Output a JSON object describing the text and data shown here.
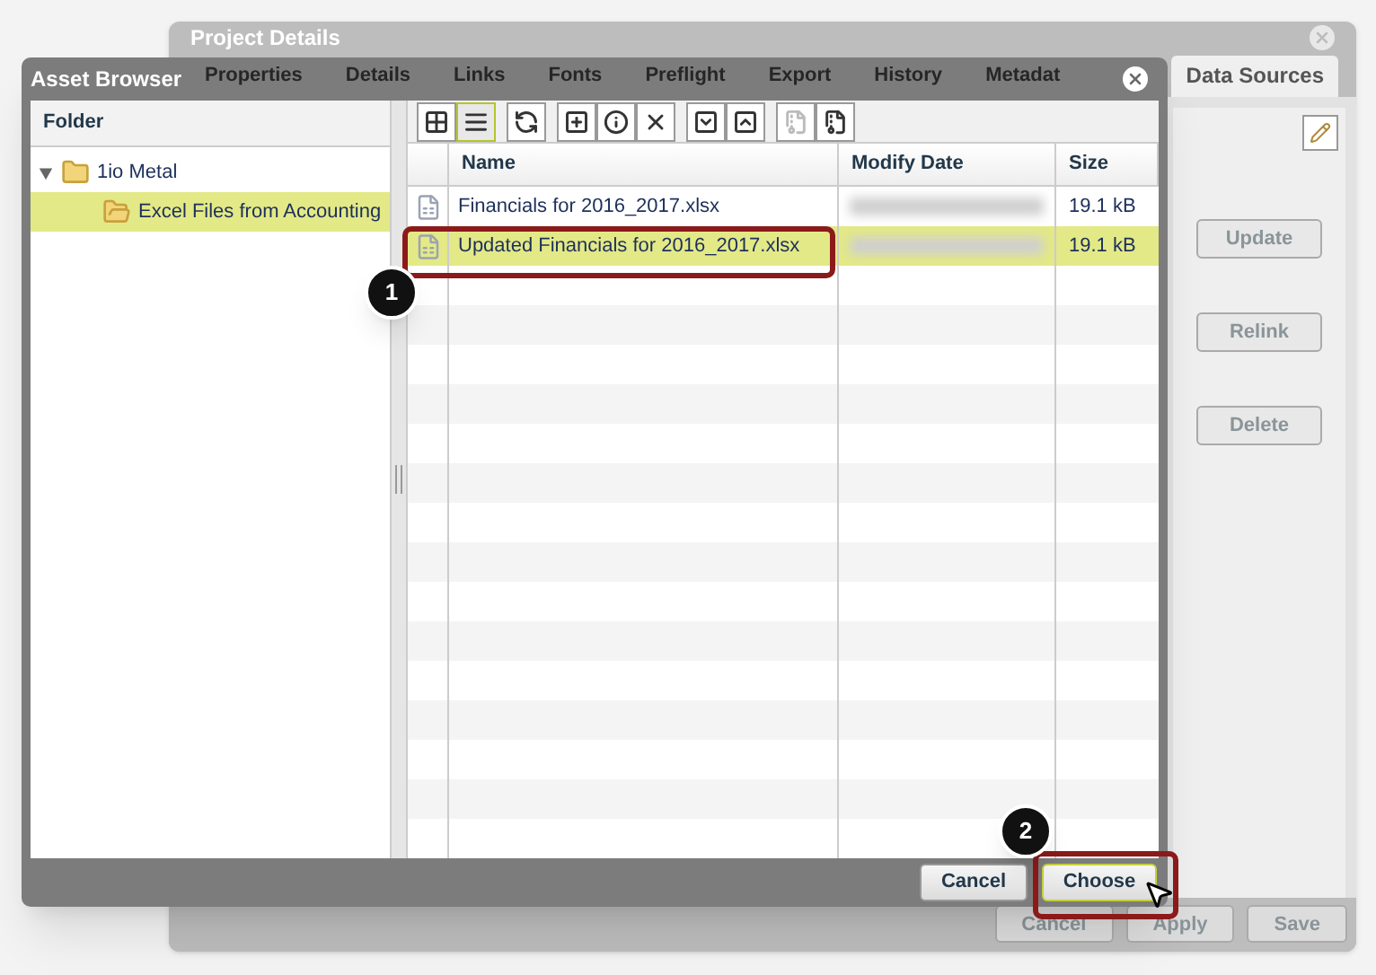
{
  "background_window": {
    "title": "Project Details",
    "tabs": [
      {
        "label": "Properties",
        "selected": false
      },
      {
        "label": "Details",
        "selected": false
      },
      {
        "label": "Links",
        "selected": false
      },
      {
        "label": "Fonts",
        "selected": false
      },
      {
        "label": "Preflight",
        "selected": false
      },
      {
        "label": "Export",
        "selected": false
      },
      {
        "label": "History",
        "selected": false
      },
      {
        "label": "Metadat",
        "selected": false
      },
      {
        "label": "Data Sources",
        "selected": true
      }
    ],
    "side_buttons": [
      "Update",
      "Relink",
      "Delete"
    ],
    "footer_buttons": [
      "Cancel",
      "Apply",
      "Save"
    ]
  },
  "dialog": {
    "title": "Asset Browser",
    "folder_header": "Folder",
    "tree": [
      {
        "label": "1io Metal",
        "expanded": true,
        "selected": false,
        "children": [
          {
            "label": "Excel Files from Accounting",
            "selected": true
          }
        ]
      }
    ],
    "toolbar": [
      [
        {
          "kind": "grid",
          "selected": false
        },
        {
          "kind": "list",
          "selected": true
        }
      ],
      [
        {
          "kind": "refresh",
          "selected": false
        }
      ],
      [
        {
          "kind": "new",
          "selected": false
        },
        {
          "kind": "info",
          "selected": false
        },
        {
          "kind": "delete",
          "selected": false
        }
      ],
      [
        {
          "kind": "down",
          "selected": false
        },
        {
          "kind": "up",
          "selected": false
        }
      ],
      [
        {
          "kind": "archive",
          "selected": false,
          "disabled": true
        },
        {
          "kind": "archive",
          "selected": false,
          "disabled": false
        }
      ]
    ],
    "columns": [
      "Name",
      "Modify Date",
      "Size"
    ],
    "rows": [
      {
        "name": "Financials for 2016_2017.xlsx",
        "size": "19.1 kB",
        "selected": false
      },
      {
        "name": "Updated Financials for 2016_2017.xlsx",
        "size": "19.1 kB",
        "selected": true
      }
    ],
    "buttons": [
      {
        "label": "Cancel",
        "focused": false
      },
      {
        "label": "Choose",
        "focused": true
      }
    ]
  },
  "callouts": [
    {
      "label": "1"
    },
    {
      "label": "2"
    }
  ]
}
